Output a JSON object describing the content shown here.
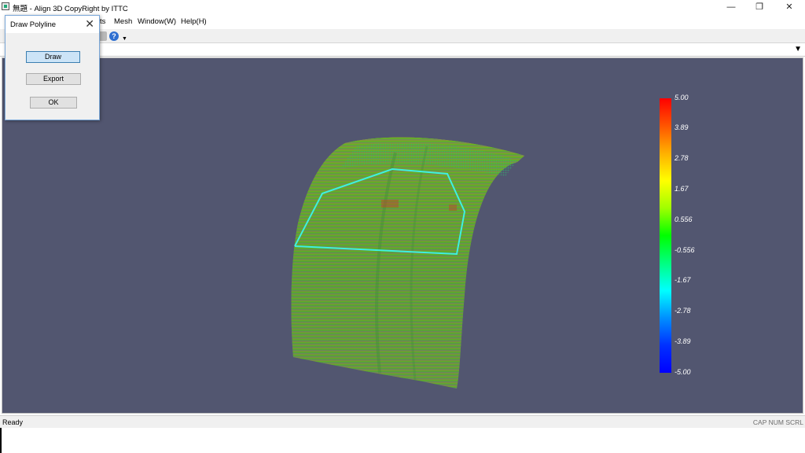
{
  "window": {
    "title": "無題 - Align 3D CopyRight by ITTC",
    "icon": "app-icon",
    "controls": [
      "minimize",
      "restore",
      "close"
    ]
  },
  "menubar": {
    "items": [
      "ts",
      "Mesh",
      "Window(W)",
      "Help(H)"
    ]
  },
  "toolbar": {
    "icons": [
      "gray-tool-icon",
      "help-icon",
      "toolbar-dropdown-icon"
    ],
    "help_glyph": "?"
  },
  "dialog": {
    "title": "Draw Polyline",
    "buttons": {
      "draw": "Draw",
      "export": "Export",
      "ok": "OK"
    }
  },
  "colorbar": {
    "labels": [
      "5.00",
      "3.89",
      "2.78",
      "1.67",
      "0.556",
      "-0.556",
      "-1.67",
      "-2.78",
      "-3.89",
      "-5.00"
    ],
    "max_color": "#ff0000",
    "min_color": "#0000ff"
  },
  "viewport": {
    "background": "#525670",
    "polyline_color": "#3ff0e0"
  },
  "statusbar": {
    "text": "Ready",
    "indicators": "CAP  NUM  SCRL"
  }
}
